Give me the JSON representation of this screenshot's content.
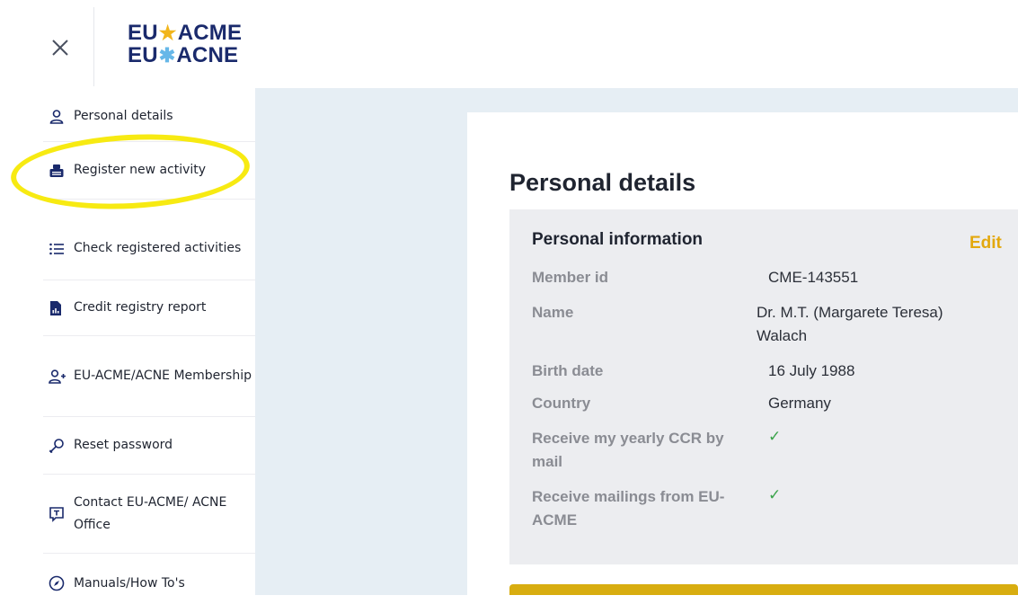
{
  "header": {
    "logo_line1_left": "EU",
    "logo_line1_right": "ACME",
    "logo_line2_left": "EU",
    "logo_line2_right": "ACNE",
    "close_icon": "close-icon"
  },
  "sidebar": {
    "items": [
      {
        "label": "Personal details",
        "icon": "user-icon"
      },
      {
        "label": "Register new activity",
        "icon": "register-activity-icon"
      },
      {
        "label": "Check registered activities",
        "icon": "list-icon"
      },
      {
        "label": "Credit registry report",
        "icon": "report-icon"
      },
      {
        "label": "EU-ACME/ACNE Membership",
        "icon": "add-user-icon"
      },
      {
        "label": "Reset password",
        "icon": "key-icon"
      },
      {
        "label": "Contact EU-ACME/ ACNE Office",
        "icon": "chat-icon"
      },
      {
        "label": "Manuals/How To's",
        "icon": "compass-icon"
      }
    ]
  },
  "main": {
    "title": "Personal details",
    "section_title": "Personal information",
    "edit_label": "Edit",
    "fields": [
      {
        "label": "Member id",
        "value": "CME-143551"
      },
      {
        "label": "Name",
        "value": "Dr. M.T. (Margarete Teresa) Walach"
      },
      {
        "label": "Birth date",
        "value": "16 July 1988"
      },
      {
        "label": "Country",
        "value": "Germany"
      },
      {
        "label": "Receive my yearly CCR by mail",
        "value": "✓"
      },
      {
        "label": "Receive mailings from EU-ACME",
        "value": "✓"
      }
    ]
  },
  "colors": {
    "accent_yellow": "#e3a80e",
    "highlight": "#f7ea12",
    "logo_blue": "#1a2a6c",
    "check_green": "#3aa34a",
    "background": "#e6eef4"
  }
}
